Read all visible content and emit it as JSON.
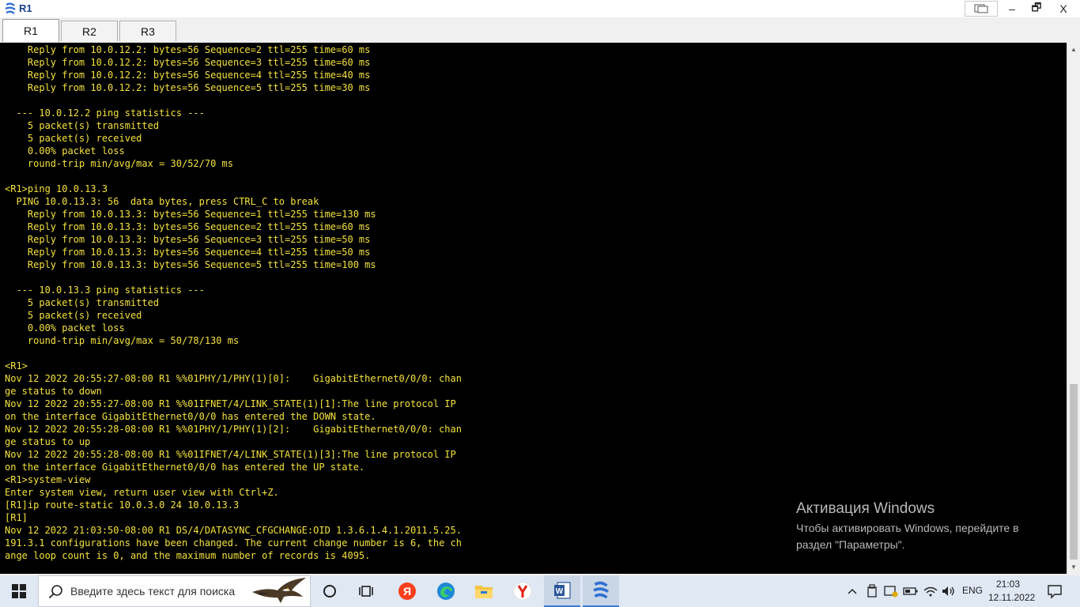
{
  "window": {
    "title": "R1",
    "buttons": {
      "minimize": "–",
      "maximize": "🗗",
      "close": "X"
    }
  },
  "tabs": [
    {
      "label": "R1",
      "active": true
    },
    {
      "label": "R2",
      "active": false
    },
    {
      "label": "R3",
      "active": false
    }
  ],
  "terminal": {
    "lines": [
      "    Reply from 10.0.12.2: bytes=56 Sequence=2 ttl=255 time=60 ms",
      "    Reply from 10.0.12.2: bytes=56 Sequence=3 ttl=255 time=60 ms",
      "    Reply from 10.0.12.2: bytes=56 Sequence=4 ttl=255 time=40 ms",
      "    Reply from 10.0.12.2: bytes=56 Sequence=5 ttl=255 time=30 ms",
      "",
      "  --- 10.0.12.2 ping statistics ---",
      "    5 packet(s) transmitted",
      "    5 packet(s) received",
      "    0.00% packet loss",
      "    round-trip min/avg/max = 30/52/70 ms",
      "",
      "<R1>ping 10.0.13.3",
      "  PING 10.0.13.3: 56  data bytes, press CTRL_C to break",
      "    Reply from 10.0.13.3: bytes=56 Sequence=1 ttl=255 time=130 ms",
      "    Reply from 10.0.13.3: bytes=56 Sequence=2 ttl=255 time=60 ms",
      "    Reply from 10.0.13.3: bytes=56 Sequence=3 ttl=255 time=50 ms",
      "    Reply from 10.0.13.3: bytes=56 Sequence=4 ttl=255 time=50 ms",
      "    Reply from 10.0.13.3: bytes=56 Sequence=5 ttl=255 time=100 ms",
      "",
      "  --- 10.0.13.3 ping statistics ---",
      "    5 packet(s) transmitted",
      "    5 packet(s) received",
      "    0.00% packet loss",
      "    round-trip min/avg/max = 50/78/130 ms",
      "",
      "<R1>",
      "Nov 12 2022 20:55:27-08:00 R1 %%01PHY/1/PHY(1)[0]:    GigabitEthernet0/0/0: chan",
      "ge status to down",
      "Nov 12 2022 20:55:27-08:00 R1 %%01IFNET/4/LINK_STATE(1)[1]:The line protocol IP",
      "on the interface GigabitEthernet0/0/0 has entered the DOWN state.",
      "Nov 12 2022 20:55:28-08:00 R1 %%01PHY/1/PHY(1)[2]:    GigabitEthernet0/0/0: chan",
      "ge status to up",
      "Nov 12 2022 20:55:28-08:00 R1 %%01IFNET/4/LINK_STATE(1)[3]:The line protocol IP",
      "on the interface GigabitEthernet0/0/0 has entered the UP state.",
      "<R1>system-view",
      "Enter system view, return user view with Ctrl+Z.",
      "[R1]ip route-static 10.0.3.0 24 10.0.13.3",
      "[R1]",
      "Nov 12 2022 21:03:50-08:00 R1 DS/4/DATASYNC_CFGCHANGE:OID 1.3.6.1.4.1.2011.5.25.",
      "191.3.1 configurations have been changed. The current change number is 6, the ch",
      "ange loop count is 0, and the maximum number of records is 4095."
    ]
  },
  "watermark": {
    "title": "Активация Windows",
    "line1": "Чтобы активировать Windows, перейдите в",
    "line2": "раздел \"Параметры\"."
  },
  "taskbar": {
    "search_placeholder": "Введите здесь текст для поиска",
    "apps": [
      {
        "icon": "cortana-circle-icon"
      },
      {
        "icon": "task-view-icon"
      },
      {
        "icon": "yandex-icon"
      },
      {
        "icon": "edge-icon"
      },
      {
        "icon": "file-explorer-icon"
      },
      {
        "icon": "yandex-browser-icon"
      },
      {
        "icon": "word-icon"
      },
      {
        "icon": "ensp-icon"
      }
    ],
    "language": "ENG",
    "time": "21:03",
    "date": "12.11.2022"
  },
  "colors": {
    "terminal_bg": "#000000",
    "terminal_fg": "#f4e23c",
    "taskbar_bg": "#dfe8f3",
    "title_color": "#1a3f8a"
  }
}
